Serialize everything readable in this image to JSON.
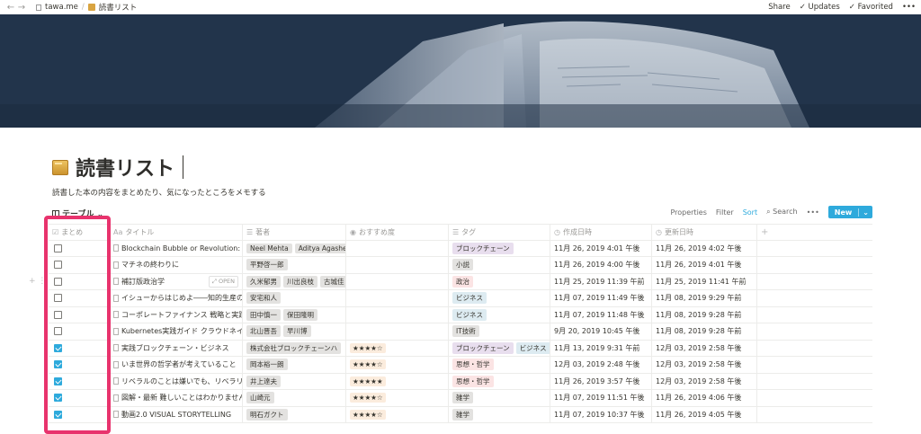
{
  "topbar": {
    "site": "tawa.me",
    "page": "読書リスト",
    "actions": [
      "Share",
      "✓ Updates",
      "✓ Favorited",
      "•••"
    ]
  },
  "page": {
    "title": "読書リスト",
    "description": "読書した本の内容をまとめたり、気になったところをメモする"
  },
  "view": {
    "label": "テーブル ⌄",
    "actions": {
      "properties": "Properties",
      "filter": "Filter",
      "sort": "Sort",
      "search": "Search",
      "more": "•••",
      "new": "New",
      "new_arrow": "⌄"
    }
  },
  "columns": [
    {
      "label": "まとめ",
      "icon": "checkbox-icon",
      "glyph": "☑"
    },
    {
      "label": "タイトル",
      "icon": "text-icon",
      "glyph": "Aa"
    },
    {
      "label": "著者",
      "icon": "list-icon",
      "glyph": "☰"
    },
    {
      "label": "おすすめ度",
      "icon": "select-icon",
      "glyph": "◉"
    },
    {
      "label": "タグ",
      "icon": "multi-select-icon",
      "glyph": "☰"
    },
    {
      "label": "作成日時",
      "icon": "clock-icon",
      "glyph": "◷"
    },
    {
      "label": "更新日時",
      "icon": "clock-icon",
      "glyph": "◷"
    }
  ],
  "add_column": "+",
  "rows": [
    {
      "checked": false,
      "title": "Blockchain Bubble or Revolution: The",
      "authors": [
        "Neel Mehta",
        "Aditya Agashe"
      ],
      "rating": "",
      "tags": [
        {
          "label": "ブロックチェーン",
          "color": "#e8deee"
        }
      ],
      "created": "11月 26, 2019 4:01 午後",
      "updated": "11月 26, 2019 4:02 午後"
    },
    {
      "checked": false,
      "title": "マチネの終わりに",
      "authors": [
        "平野啓一郎"
      ],
      "rating": "",
      "tags": [
        {
          "label": "小説",
          "color": "#e3e2e0"
        }
      ],
      "created": "11月 26, 2019 4:00 午後",
      "updated": "11月 26, 2019 4:01 午後"
    },
    {
      "checked": false,
      "title": "補訂版政治学",
      "open": "⤢ OPEN",
      "authors": [
        "久米郁男",
        "川出良枝",
        "古城佳"
      ],
      "rating": "",
      "tags": [
        {
          "label": "政治",
          "color": "#fbe4e4"
        }
      ],
      "created": "11月 25, 2019 11:39 午前",
      "updated": "11月 25, 2019 11:41 午前"
    },
    {
      "checked": false,
      "title": "イシューからはじめよ――知的生産の",
      "authors": [
        "安宅和人"
      ],
      "rating": "",
      "tags": [
        {
          "label": "ビジネス",
          "color": "#ddebf1"
        }
      ],
      "created": "11月 07, 2019 11:49 午後",
      "updated": "11月 08, 2019 9:29 午前"
    },
    {
      "checked": false,
      "title": "コーポレートファイナンス 戦略と実践",
      "authors": [
        "田中慎一",
        "保田隆明"
      ],
      "rating": "",
      "tags": [
        {
          "label": "ビジネス",
          "color": "#ddebf1"
        }
      ],
      "created": "11月 07, 2019 11:48 午後",
      "updated": "11月 08, 2019 9:28 午前"
    },
    {
      "checked": false,
      "title": "Kubernetes実践ガイド クラウドネイテ",
      "authors": [
        "北山晋吾",
        "早川博"
      ],
      "rating": "",
      "tags": [
        {
          "label": "IT技術",
          "color": "#e3e2e0"
        }
      ],
      "created": "9月 20, 2019 10:45 午後",
      "updated": "11月 08, 2019 9:28 午前"
    },
    {
      "checked": true,
      "title": "実践ブロックチェーン・ビジネス",
      "authors": [
        "株式会社ブロックチェーンハ"
      ],
      "rating": "★★★★☆",
      "tags": [
        {
          "label": "ブロックチェーン",
          "color": "#e8deee"
        },
        {
          "label": "ビジネス",
          "color": "#ddebf1"
        }
      ],
      "created": "11月 13, 2019 9:31 午前",
      "updated": "12月 03, 2019 2:58 午後"
    },
    {
      "checked": true,
      "title": "いま世界の哲学者が考えていること",
      "authors": [
        "岡本裕一朗"
      ],
      "rating": "★★★★☆",
      "tags": [
        {
          "label": "思想・哲学",
          "color": "#fbe4e4"
        }
      ],
      "created": "12月 03, 2019 2:48 午後",
      "updated": "12月 03, 2019 2:58 午後"
    },
    {
      "checked": true,
      "title": "リベラルのことは嫌いでも、リベラリズ",
      "authors": [
        "井上達夫"
      ],
      "rating": "★★★★★",
      "tags": [
        {
          "label": "思想・哲学",
          "color": "#fbe4e4"
        }
      ],
      "created": "11月 26, 2019 3:57 午後",
      "updated": "12月 03, 2019 2:58 午後"
    },
    {
      "checked": true,
      "title": "図解・最新 難しいことはわかりません",
      "authors": [
        "山崎元"
      ],
      "rating": "★★★★☆",
      "tags": [
        {
          "label": "雑学",
          "color": "#e3e2e0"
        }
      ],
      "created": "11月 07, 2019 11:51 午後",
      "updated": "11月 26, 2019 4:06 午後"
    },
    {
      "checked": true,
      "title": "動画2.0 VISUAL STORYTELLING",
      "authors": [
        "明石ガクト"
      ],
      "rating": "★★★★☆",
      "tags": [
        {
          "label": "雑学",
          "color": "#e3e2e0"
        }
      ],
      "created": "11月 07, 2019 10:37 午後",
      "updated": "11月 26, 2019 4:05 午後"
    }
  ]
}
